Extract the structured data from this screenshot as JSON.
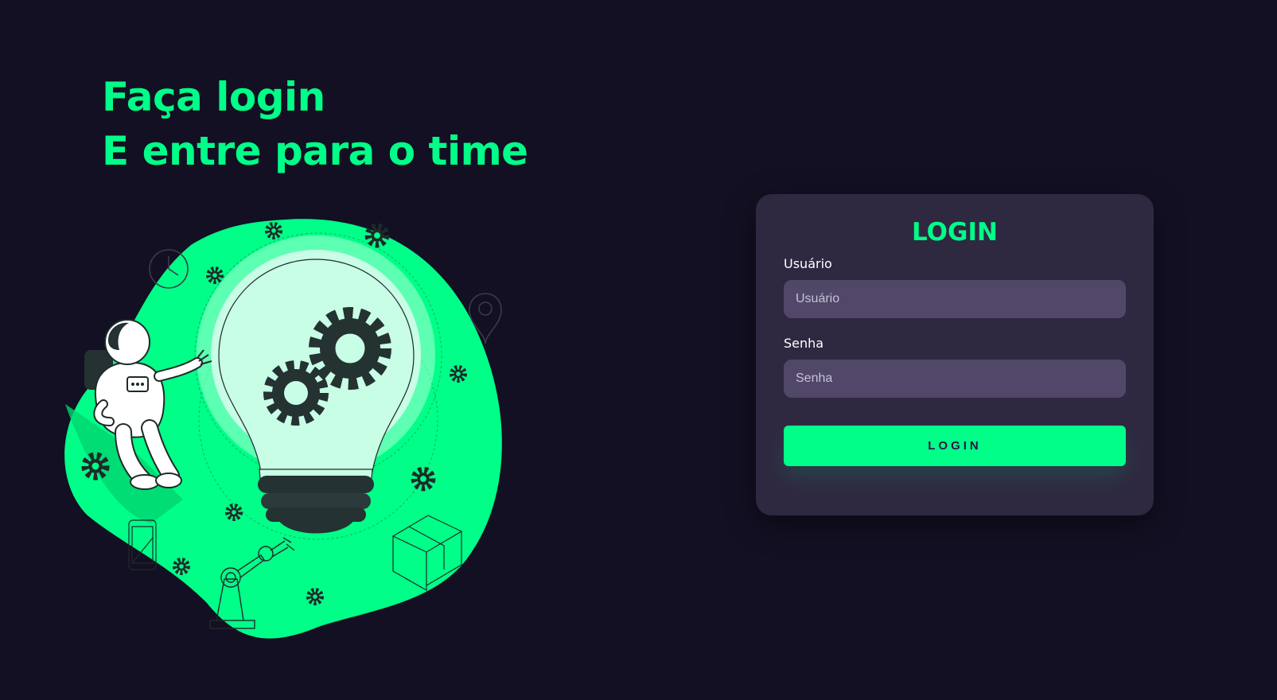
{
  "headline": {
    "line1": "Faça login",
    "line2": "E entre para o time"
  },
  "illustration": {
    "blob_color": "#00ff88",
    "icons": [
      "astronaut-icon",
      "lightbulb-icon",
      "gears-icon",
      "robot-arm-icon",
      "box-icon",
      "smartphone-icon",
      "location-pin-icon",
      "clock-icon"
    ]
  },
  "login": {
    "title": "LOGIN",
    "username": {
      "label": "Usuário",
      "placeholder": "Usuário",
      "value": ""
    },
    "password": {
      "label": "Senha",
      "placeholder": "Senha",
      "value": ""
    },
    "button_label": "LOGIN"
  },
  "colors": {
    "background": "#131023",
    "accent": "#00ff88",
    "card": "#2f2841",
    "input": "#514869"
  }
}
